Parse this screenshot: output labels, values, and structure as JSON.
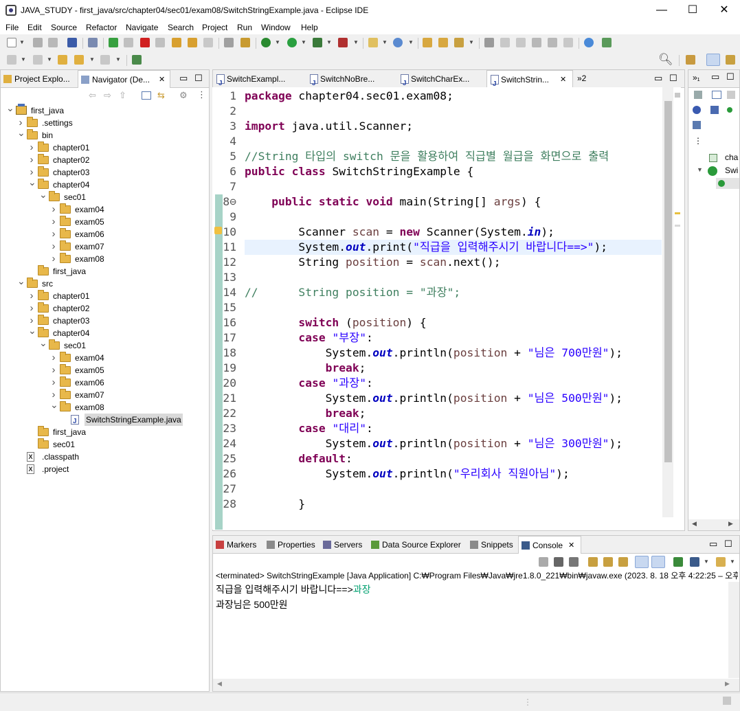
{
  "window": {
    "title": "JAVA_STUDY - first_java/src/chapter04/sec01/exam08/SwitchStringExample.java - Eclipse IDE",
    "minimize": "—",
    "maximize": "☐",
    "close": "✕"
  },
  "menu": [
    "File",
    "Edit",
    "Source",
    "Refactor",
    "Navigate",
    "Search",
    "Project",
    "Run",
    "Window",
    "Help"
  ],
  "left_panel": {
    "tabs": [
      "Project Explo...",
      "Navigator (De..."
    ],
    "tree": [
      {
        "label": "first_java",
        "depth": 0,
        "type": "project",
        "open": true
      },
      {
        "label": ".settings",
        "depth": 1,
        "type": "folder",
        "open": false
      },
      {
        "label": "bin",
        "depth": 1,
        "type": "folder",
        "open": true
      },
      {
        "label": "chapter01",
        "depth": 2,
        "type": "folder",
        "open": false
      },
      {
        "label": "chapter02",
        "depth": 2,
        "type": "folder",
        "open": false
      },
      {
        "label": "chapter03",
        "depth": 2,
        "type": "folder",
        "open": false
      },
      {
        "label": "chapter04",
        "depth": 2,
        "type": "folder",
        "open": true
      },
      {
        "label": "sec01",
        "depth": 3,
        "type": "folder",
        "open": true
      },
      {
        "label": "exam04",
        "depth": 4,
        "type": "folder",
        "open": false
      },
      {
        "label": "exam05",
        "depth": 4,
        "type": "folder",
        "open": false
      },
      {
        "label": "exam06",
        "depth": 4,
        "type": "folder",
        "open": false
      },
      {
        "label": "exam07",
        "depth": 4,
        "type": "folder",
        "open": false
      },
      {
        "label": "exam08",
        "depth": 4,
        "type": "folder",
        "open": false
      },
      {
        "label": "first_java",
        "depth": 2,
        "type": "folder",
        "leaf": true
      },
      {
        "label": "src",
        "depth": 1,
        "type": "folder",
        "open": true
      },
      {
        "label": "chapter01",
        "depth": 2,
        "type": "folder",
        "open": false
      },
      {
        "label": "chapter02",
        "depth": 2,
        "type": "folder",
        "open": false
      },
      {
        "label": "chapter03",
        "depth": 2,
        "type": "folder",
        "open": false
      },
      {
        "label": "chapter04",
        "depth": 2,
        "type": "folder",
        "open": true
      },
      {
        "label": "sec01",
        "depth": 3,
        "type": "folder",
        "open": true
      },
      {
        "label": "exam04",
        "depth": 4,
        "type": "folder",
        "open": false
      },
      {
        "label": "exam05",
        "depth": 4,
        "type": "folder",
        "open": false
      },
      {
        "label": "exam06",
        "depth": 4,
        "type": "folder",
        "open": false
      },
      {
        "label": "exam07",
        "depth": 4,
        "type": "folder",
        "open": false
      },
      {
        "label": "exam08",
        "depth": 4,
        "type": "folder",
        "open": true
      },
      {
        "label": "SwitchStringExample.java",
        "depth": 5,
        "type": "java",
        "leaf": true,
        "selected": true
      },
      {
        "label": "first_java",
        "depth": 2,
        "type": "folder",
        "leaf": true
      },
      {
        "label": "sec01",
        "depth": 2,
        "type": "folder",
        "leaf": true
      },
      {
        "label": ".classpath",
        "depth": 1,
        "type": "xfile",
        "leaf": true
      },
      {
        "label": ".project",
        "depth": 1,
        "type": "xfile",
        "leaf": true
      }
    ]
  },
  "editor": {
    "tabs": [
      "SwitchExampl...",
      "SwitchNoBre...",
      "SwitchCharEx...",
      "SwitchStrin..."
    ],
    "overflow": "»2",
    "lines": [
      [
        {
          "t": "package",
          "c": "kw"
        },
        {
          "t": " chapter04.sec01.exam08;"
        }
      ],
      [],
      [
        {
          "t": "import",
          "c": "kw"
        },
        {
          "t": " java.util.Scanner;"
        }
      ],
      [],
      [
        {
          "t": "//String 타입의 switch 문을 활용하여 직급별 월급을 화면으로 출력",
          "c": "cm"
        }
      ],
      [
        {
          "t": "public",
          "c": "kw"
        },
        {
          "t": " "
        },
        {
          "t": "class",
          "c": "kw"
        },
        {
          "t": " SwitchStringExample {"
        }
      ],
      [],
      [
        {
          "t": "    "
        },
        {
          "t": "public",
          "c": "kw"
        },
        {
          "t": " "
        },
        {
          "t": "static",
          "c": "kw"
        },
        {
          "t": " "
        },
        {
          "t": "void",
          "c": "kw"
        },
        {
          "t": " main(String[] "
        },
        {
          "t": "args",
          "c": "var"
        },
        {
          "t": ") {"
        }
      ],
      [],
      [
        {
          "t": "        Scanner "
        },
        {
          "t": "scan",
          "c": "var"
        },
        {
          "t": " = "
        },
        {
          "t": "new",
          "c": "kw"
        },
        {
          "t": " Scanner(System."
        },
        {
          "t": "in",
          "c": "fld"
        },
        {
          "t": ");"
        }
      ],
      [
        {
          "t": "        System."
        },
        {
          "t": "out",
          "c": "fld"
        },
        {
          "t": ".print("
        },
        {
          "t": "\"직급을 입력해주시기 바랍니다==>\"",
          "c": "str"
        },
        {
          "t": ");"
        }
      ],
      [
        {
          "t": "        String "
        },
        {
          "t": "position",
          "c": "var"
        },
        {
          "t": " = "
        },
        {
          "t": "scan",
          "c": "var"
        },
        {
          "t": ".next();"
        }
      ],
      [],
      [
        {
          "t": "//      String position = \"과장\";",
          "c": "cm"
        }
      ],
      [],
      [
        {
          "t": "        "
        },
        {
          "t": "switch",
          "c": "kw"
        },
        {
          "t": " ("
        },
        {
          "t": "position",
          "c": "var"
        },
        {
          "t": ") {"
        }
      ],
      [
        {
          "t": "        "
        },
        {
          "t": "case",
          "c": "kw"
        },
        {
          "t": " "
        },
        {
          "t": "\"부장\"",
          "c": "str"
        },
        {
          "t": ":"
        }
      ],
      [
        {
          "t": "            System."
        },
        {
          "t": "out",
          "c": "fld"
        },
        {
          "t": ".println("
        },
        {
          "t": "position",
          "c": "var"
        },
        {
          "t": " + "
        },
        {
          "t": "\"님은 700만원\"",
          "c": "str"
        },
        {
          "t": ");"
        }
      ],
      [
        {
          "t": "            "
        },
        {
          "t": "break",
          "c": "kw"
        },
        {
          "t": ";"
        }
      ],
      [
        {
          "t": "        "
        },
        {
          "t": "case",
          "c": "kw"
        },
        {
          "t": " "
        },
        {
          "t": "\"과장\"",
          "c": "str"
        },
        {
          "t": ":"
        }
      ],
      [
        {
          "t": "            System."
        },
        {
          "t": "out",
          "c": "fld"
        },
        {
          "t": ".println("
        },
        {
          "t": "position",
          "c": "var"
        },
        {
          "t": " + "
        },
        {
          "t": "\"님은 500만원\"",
          "c": "str"
        },
        {
          "t": ");"
        }
      ],
      [
        {
          "t": "            "
        },
        {
          "t": "break",
          "c": "kw"
        },
        {
          "t": ";"
        }
      ],
      [
        {
          "t": "        "
        },
        {
          "t": "case",
          "c": "kw"
        },
        {
          "t": " "
        },
        {
          "t": "\"대리\"",
          "c": "str"
        },
        {
          "t": ":"
        }
      ],
      [
        {
          "t": "            System."
        },
        {
          "t": "out",
          "c": "fld"
        },
        {
          "t": ".println("
        },
        {
          "t": "position",
          "c": "var"
        },
        {
          "t": " + "
        },
        {
          "t": "\"님은 300만원\"",
          "c": "str"
        },
        {
          "t": ");"
        }
      ],
      [
        {
          "t": "        "
        },
        {
          "t": "default",
          "c": "kw"
        },
        {
          "t": ":"
        }
      ],
      [
        {
          "t": "            System."
        },
        {
          "t": "out",
          "c": "fld"
        },
        {
          "t": ".println("
        },
        {
          "t": "\"우리회사 직원아님\"",
          "c": "str"
        },
        {
          "t": ");"
        }
      ],
      [],
      [
        {
          "t": "        }"
        }
      ]
    ],
    "line_numbers": [
      "1",
      "2",
      "3",
      "4",
      "5",
      "6",
      "7",
      "8⊖",
      "9",
      "10",
      "11",
      "12",
      "13",
      "14",
      "15",
      "16",
      "17",
      "18",
      "19",
      "20",
      "21",
      "22",
      "23",
      "24",
      "25",
      "26",
      "27",
      "28"
    ]
  },
  "outline": {
    "items": [
      "cha",
      "Swi"
    ]
  },
  "bottom_panel": {
    "tabs": [
      "Markers",
      "Properties",
      "Servers",
      "Data Source Explorer",
      "Snippets",
      "Console"
    ],
    "status": "<terminated> SwitchStringExample [Java Application] C:₩Program Files₩Java₩jre1.8.0_221₩bin₩javaw.exe  (2023. 8. 18 오후 4:22:25 – 오후",
    "console_prompt": "직급을 입력해주시기 바랍니다==>",
    "console_input": "과장",
    "console_output": "과장님은 500만원"
  },
  "colors": {
    "keyword": "#7f0055",
    "string": "#2a00ff",
    "comment": "#3f7f5f",
    "field": "#0000c0",
    "console_input": "#00a070"
  }
}
